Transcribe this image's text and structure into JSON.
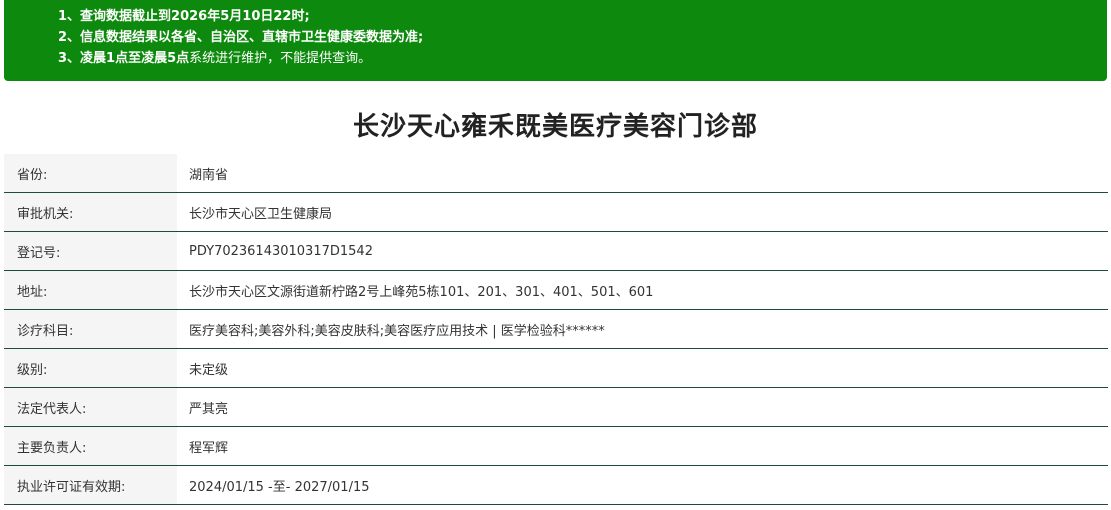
{
  "notice": {
    "lines": [
      {
        "num": "1、",
        "text": "查询数据截止到2026年5月10日22时;"
      },
      {
        "num": "2、",
        "text": "信息数据结果以各省、自治区、直辖市卫生健康委数据为准;"
      },
      {
        "num": "3、",
        "text_bold": "凌晨1点至凌晨5点",
        "text_normal": "系统进行维护，不能提供查询。"
      }
    ]
  },
  "page_title": "长沙天心雍禾既美医疗美容门诊部",
  "rows": [
    {
      "label": "省份:",
      "value": "湖南省"
    },
    {
      "label": "审批机关:",
      "value": "长沙市天心区卫生健康局"
    },
    {
      "label": "登记号:",
      "value": "PDY70236143010317D1542"
    },
    {
      "label": "地址:",
      "value": "长沙市天心区文源街道新柠路2号上峰苑5栋101、201、301、401、501、601"
    },
    {
      "label": "诊疗科目:",
      "value": "医疗美容科;美容外科;美容皮肤科;美容医疗应用技术 | 医学检验科******"
    },
    {
      "label": "级别:",
      "value": "未定级"
    },
    {
      "label": "法定代表人:",
      "value": "严其亮"
    },
    {
      "label": "主要负责人:",
      "value": "程军辉"
    },
    {
      "label": "执业许可证有效期:",
      "value": "2024/01/15 -至- 2027/01/15"
    }
  ]
}
